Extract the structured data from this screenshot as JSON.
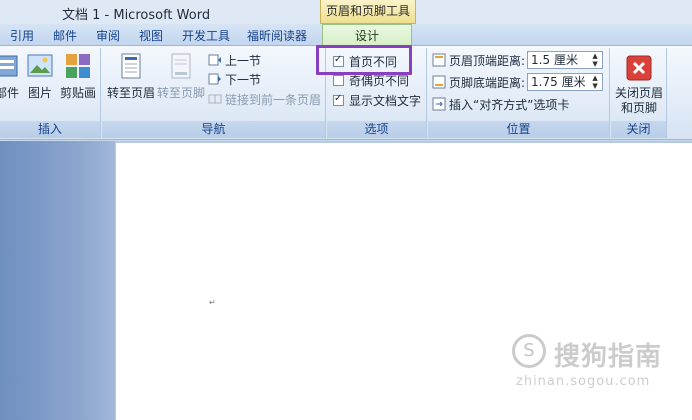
{
  "window": {
    "title": "文档 1 - Microsoft Word",
    "context_tab_title": "页眉和页脚工具"
  },
  "tabs": [
    {
      "label": "引用"
    },
    {
      "label": "邮件"
    },
    {
      "label": "审阅"
    },
    {
      "label": "视图"
    },
    {
      "label": "开发工具"
    },
    {
      "label": "福昕阅读器"
    },
    {
      "label": "设计",
      "active": true
    }
  ],
  "groups": {
    "insert": {
      "label": "插入",
      "buttons": [
        {
          "label": "部件",
          "icon": "quick-parts-icon"
        },
        {
          "label": "图片",
          "icon": "picture-icon"
        },
        {
          "label": "剪贴画",
          "icon": "clipart-icon"
        }
      ]
    },
    "navigation": {
      "label": "导航",
      "goto_header": "转至页眉",
      "goto_footer": "转至页脚",
      "previous": "上一节",
      "next": "下一节",
      "link_previous": "链接到前一条页眉"
    },
    "options": {
      "label": "选项",
      "different_first_page": {
        "label": "首页不同",
        "checked": true
      },
      "different_odd_even": {
        "label": "奇偶页不同",
        "checked": false
      },
      "show_document_text": {
        "label": "显示文档文字",
        "checked": true
      }
    },
    "position": {
      "label": "位置",
      "header_from_top": {
        "label": "页眉顶端距离:",
        "value": "1.5 厘米"
      },
      "footer_from_bottom": {
        "label": "页脚底端距离:",
        "value": "1.75 厘米"
      },
      "insert_alignment_tab": "插入“对齐方式”选项卡"
    },
    "close": {
      "label": "关闭",
      "close_header_footer": "关闭页眉\n和页脚"
    }
  },
  "document": {
    "paragraph_mark": "↵"
  },
  "watermark": {
    "text": "搜狗指南",
    "url": "zhinan.sogou.com",
    "logo": "S"
  },
  "colors": {
    "highlight": "#8a3fbf",
    "accent": "#15428b",
    "close_red": "#d9413a"
  }
}
